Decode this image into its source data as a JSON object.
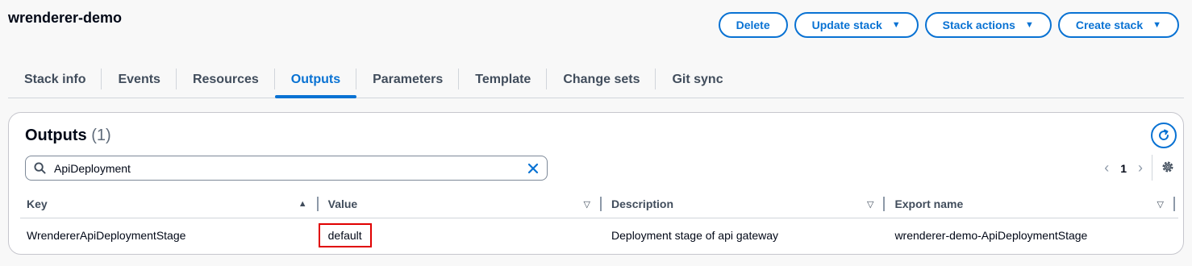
{
  "stack": {
    "name": "wrenderer-demo"
  },
  "actions": {
    "delete": "Delete",
    "update_stack": "Update stack",
    "stack_actions": "Stack actions",
    "create_stack": "Create stack"
  },
  "tabs": [
    {
      "label": "Stack info"
    },
    {
      "label": "Events"
    },
    {
      "label": "Resources"
    },
    {
      "label": "Outputs",
      "active": true
    },
    {
      "label": "Parameters"
    },
    {
      "label": "Template"
    },
    {
      "label": "Change sets"
    },
    {
      "label": "Git sync"
    }
  ],
  "outputs_panel": {
    "title": "Outputs",
    "count": "(1)",
    "search": {
      "value": "ApiDeployment"
    },
    "pagination": {
      "current_page": "1"
    },
    "columns": [
      "Key",
      "Value",
      "Description",
      "Export name"
    ],
    "rows": [
      {
        "key": "WrendererApiDeploymentStage",
        "value": "default",
        "description": "Deployment stage of api gateway",
        "export_name": "wrenderer-demo-ApiDeploymentStage"
      }
    ]
  },
  "colors": {
    "accent": "#0972d3",
    "highlight_border": "#e00000"
  }
}
